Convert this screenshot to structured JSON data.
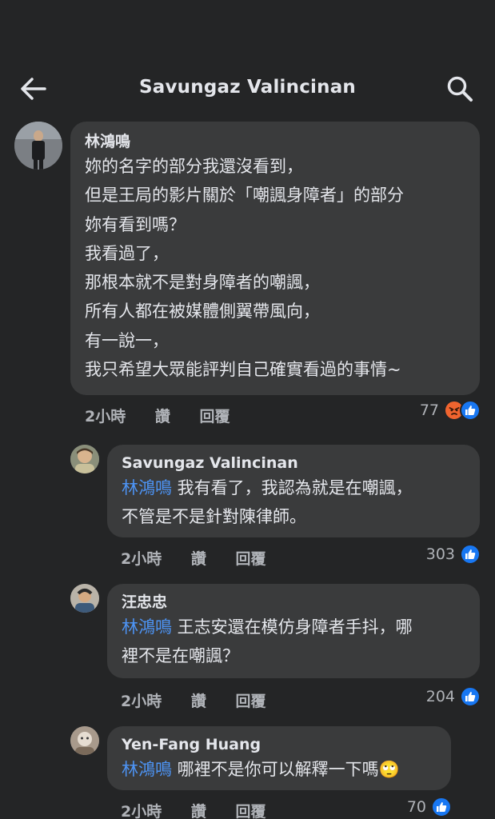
{
  "header": {
    "title": "Savungaz Valincinan"
  },
  "comments": [
    {
      "author": "林鴻鳴",
      "lines": [
        "妳的名字的部分我還沒看到，",
        "但是王局的影片關於「嘲諷身障者」的部分",
        "妳有看到嗎？",
        "我看過了，",
        "那根本就不是對身障者的嘲諷，",
        "所有人都在被媒體側翼帶風向，",
        "有一說一，",
        "我只希望大眾能評判自己確實看過的事情~"
      ],
      "time": "2小時",
      "like_label": "讚",
      "reply_label": "回覆",
      "reaction_count": "77",
      "reactions": [
        "angry",
        "like"
      ]
    },
    {
      "author": "Savungaz Valincinan",
      "mention": "林鴻鳴",
      "lines": [
        " 我有看了，我認為就是在嘲諷，",
        "不管是不是針對陳律師。"
      ],
      "time": "2小時",
      "like_label": "讚",
      "reply_label": "回覆",
      "reaction_count": "303",
      "reactions": [
        "like"
      ]
    },
    {
      "author": "汪忠忠",
      "mention": "林鴻鳴",
      "lines": [
        " 王志安還在模仿身障者手抖，哪",
        "裡不是在嘲諷？"
      ],
      "time": "2小時",
      "like_label": "讚",
      "reply_label": "回覆",
      "reaction_count": "204",
      "reactions": [
        "like"
      ]
    },
    {
      "author": "Yen-Fang Huang",
      "mention": "林鴻鳴",
      "lines": [
        " 哪裡不是你可以解釋一下嗎🙄"
      ],
      "time": "2小時",
      "like_label": "讚",
      "reply_label": "回覆",
      "reaction_count": "70",
      "reactions": [
        "like"
      ]
    }
  ],
  "colors": {
    "background": "#242526",
    "bubble": "#3a3b3c",
    "mention": "#4d94f5",
    "like_blue": "#1877f2",
    "angry_orange": "#f0642f"
  },
  "icons": {
    "back": "arrow-left-icon",
    "search": "search-icon",
    "like": "thumbs-up-icon",
    "angry": "angry-face-icon"
  }
}
